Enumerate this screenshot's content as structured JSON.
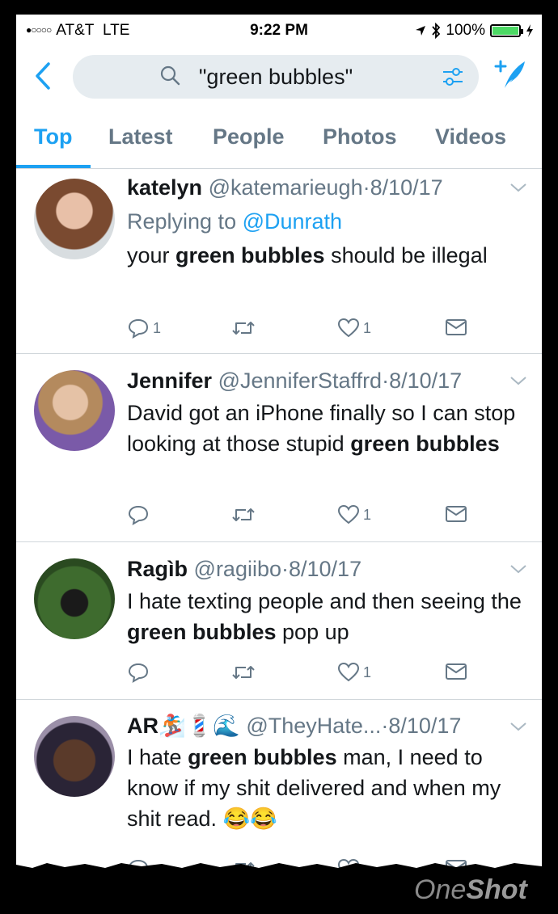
{
  "status": {
    "carrier": "AT&T",
    "network": "LTE",
    "time": "9:22 PM",
    "battery": "100%"
  },
  "search": {
    "query": "\"green bubbles\""
  },
  "tabs": [
    "Top",
    "Latest",
    "People",
    "Photos",
    "Videos"
  ],
  "tweets": [
    {
      "name": "katelyn",
      "handle": "@katemarieugh",
      "date": "8/10/17",
      "replying_label": "Replying to",
      "replying_to": "@Dunrath",
      "text_before": "your ",
      "bold": "green bubbles",
      "text_after": " should be illegal",
      "replies": "1",
      "likes": "1"
    },
    {
      "name": "Jennifer",
      "handle": "@JenniferStaffrd",
      "date": "8/10/17",
      "text_before": "David got an iPhone finally so I can stop looking at those stupid ",
      "bold": "green bubbles",
      "text_after": "",
      "replies": "",
      "likes": "1"
    },
    {
      "name": "Ragìb",
      "handle": "@ragiibo",
      "date": "8/10/17",
      "text_before": "I hate texting people and then seeing the ",
      "bold": "green bubbles",
      "text_after": " pop up",
      "replies": "",
      "likes": "1"
    },
    {
      "name": "AR🏂💈🌊",
      "handle": "@TheyHate...",
      "date": "8/10/17",
      "text_before": "I hate ",
      "bold": "green bubbles",
      "text_after": " man, I need to know if my shit delivered and when my shit read. 😂😂",
      "replies": "",
      "likes": ""
    }
  ],
  "watermark": {
    "one": "One",
    "shot": "Shot"
  },
  "colors": {
    "accent": "#1da1f2",
    "muted": "#657786",
    "battery": "#4cd964"
  }
}
